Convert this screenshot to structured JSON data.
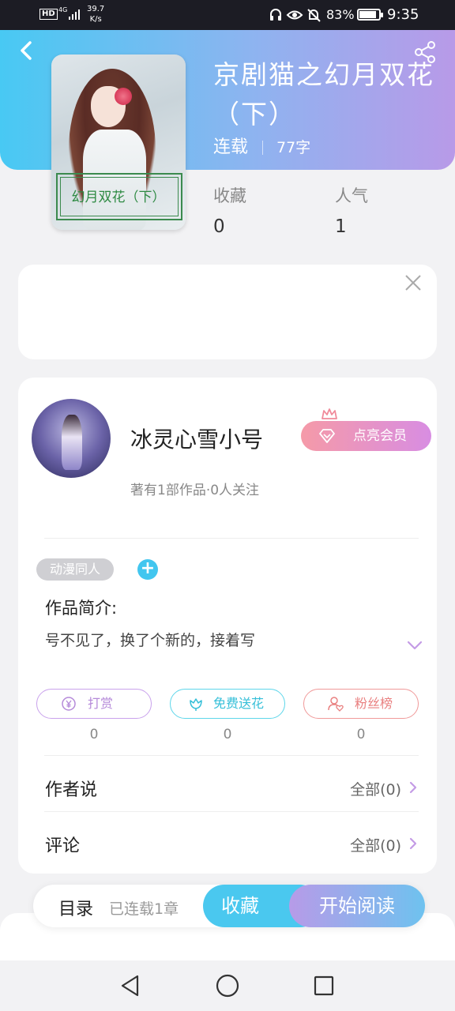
{
  "status_bar": {
    "hd": "HD",
    "network": "4G",
    "speed_value": "39.7",
    "speed_unit": "K/s",
    "battery_pct": "83%",
    "time": "9:35"
  },
  "book": {
    "cover_title": "幻月双花（下）",
    "title": "京剧猫之幻月双花（下）",
    "status": "连载",
    "word_count": "77字",
    "favorites_label": "收藏",
    "favorites_value": "0",
    "popularity_label": "人气",
    "popularity_value": "1"
  },
  "author": {
    "name": "冰灵心雪小号",
    "subtitle": "著有1部作品·0人关注",
    "vip_label": "点亮会员"
  },
  "tags": [
    "动漫同人"
  ],
  "intro": {
    "heading": "作品简介:",
    "text": "号不见了，换了个新的，接着写"
  },
  "actions": [
    {
      "label": "打赏",
      "count": "0"
    },
    {
      "label": "免费送花",
      "count": "0"
    },
    {
      "label": "粉丝榜",
      "count": "0"
    }
  ],
  "rows": {
    "author_says": {
      "title": "作者说",
      "all": "全部(0)"
    },
    "comments": {
      "title": "评论",
      "all": "全部(0)"
    }
  },
  "bottom_bar": {
    "toc_label": "目录",
    "chapter_count": "已连载1章",
    "collect_label": "收藏",
    "read_label": "开始阅读"
  },
  "colors": {
    "header_start": "#48c9f3",
    "header_end": "#b89ae8",
    "accent_blue": "#4ac8ef",
    "accent_purple": "#b79be8",
    "vip_pink": "#f59aa8"
  },
  "icons": [
    "back-icon",
    "share-icon",
    "close-icon",
    "diamond-icon",
    "crown-icon",
    "plus-icon",
    "chevron-down-icon",
    "yuan-icon",
    "flower-icon",
    "fans-icon",
    "chevron-right-icon",
    "nav-back-icon",
    "nav-home-icon",
    "nav-recent-icon"
  ]
}
